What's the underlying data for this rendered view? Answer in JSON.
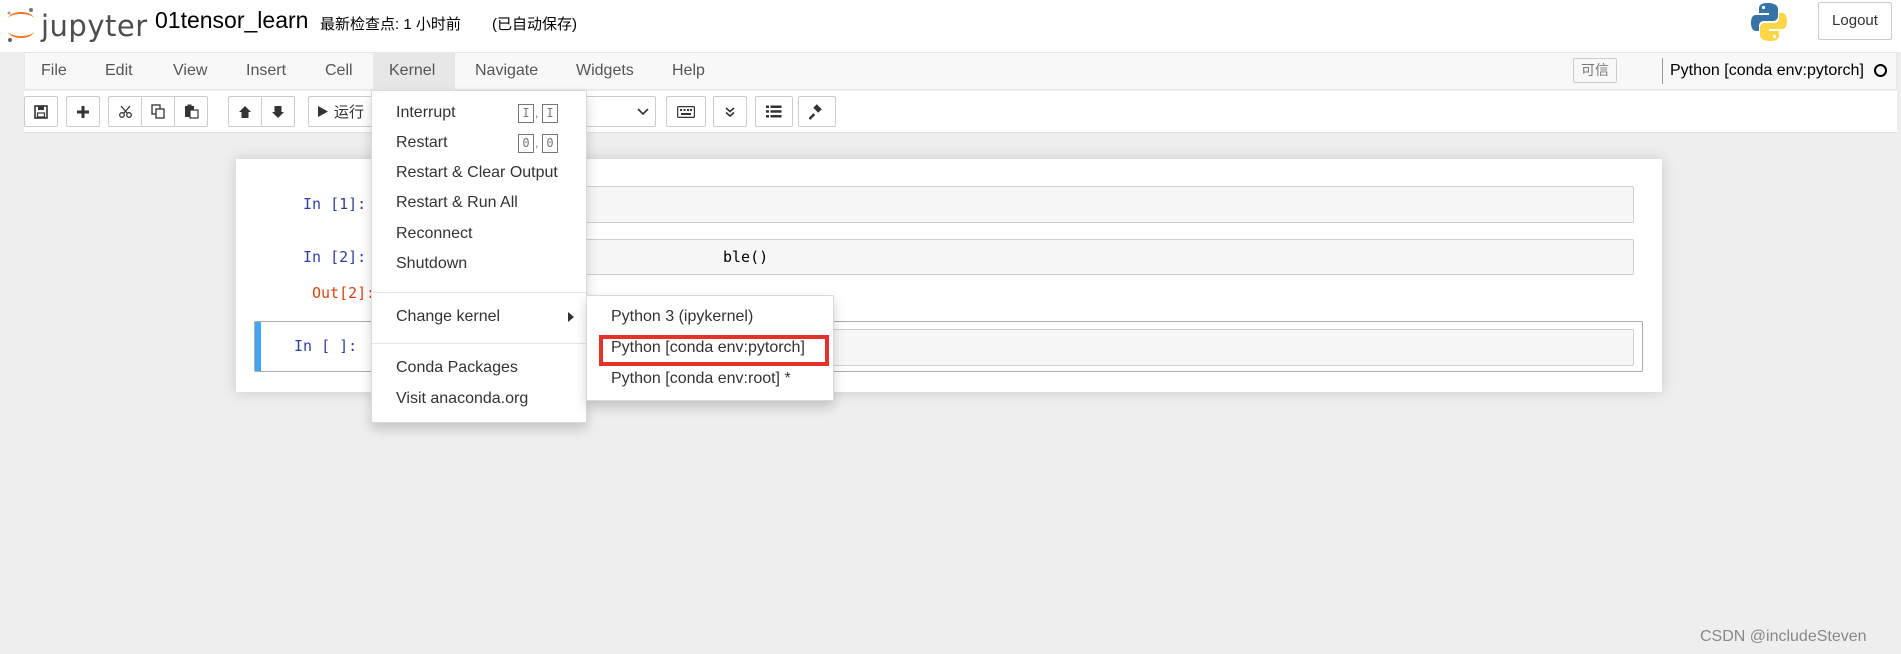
{
  "header": {
    "logo_text": "jupyter",
    "notebook_name": "01tensor_learn",
    "checkpoint": "最新检查点: 1 小时前",
    "autosave": "(已自动保存)",
    "logout_label": "Logout"
  },
  "menubar": {
    "items": [
      {
        "label": "File"
      },
      {
        "label": "Edit"
      },
      {
        "label": "View"
      },
      {
        "label": "Insert"
      },
      {
        "label": "Cell"
      },
      {
        "label": "Kernel"
      },
      {
        "label": "Navigate"
      },
      {
        "label": "Widgets"
      },
      {
        "label": "Help"
      }
    ],
    "trusted_label": "可信",
    "kernel_name": "Python [conda env:pytorch]"
  },
  "toolbar": {
    "run_label": "运行"
  },
  "cells": [
    {
      "prompt": "In  [1]:",
      "code": ""
    },
    {
      "prompt": "In  [2]:",
      "code": "ble()"
    },
    {
      "out_prompt": "Out[2]:"
    },
    {
      "prompt": "In  [ ]:",
      "code": ""
    }
  ],
  "kernel_menu": {
    "items": [
      {
        "label": "Interrupt",
        "shortcut": [
          "I",
          "I"
        ]
      },
      {
        "label": "Restart",
        "shortcut": [
          "0",
          "0"
        ]
      },
      {
        "label": "Restart & Clear Output"
      },
      {
        "label": "Restart & Run All"
      },
      {
        "label": "Reconnect"
      },
      {
        "label": "Shutdown"
      },
      {
        "label": "Change kernel"
      },
      {
        "label": "Conda Packages"
      },
      {
        "label": "Visit anaconda.org"
      }
    ]
  },
  "change_kernel_menu": {
    "items": [
      {
        "label": "Python 3 (ipykernel)"
      },
      {
        "label": "Python [conda env:pytorch]"
      },
      {
        "label": "Python [conda env:root] *"
      }
    ]
  },
  "watermark": "CSDN @includeSteven",
  "colors": {
    "highlight": "#e5302c",
    "selected_cell_bar": "#42a5f5",
    "in_prompt": "#303f9f",
    "out_prompt": "#d84315"
  }
}
